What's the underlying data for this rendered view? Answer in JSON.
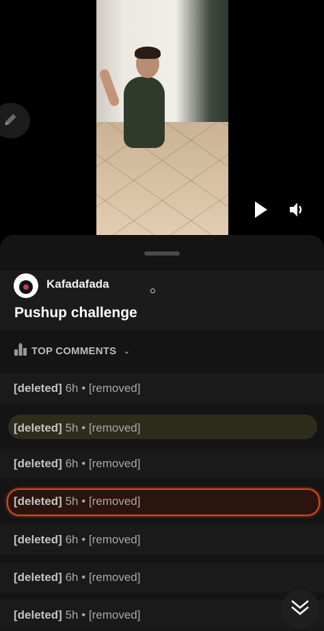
{
  "post": {
    "username": "Kafadafada",
    "title": "Pushup challenge"
  },
  "comments_header": {
    "label": "TOP COMMENTS",
    "chevron": "⌄"
  },
  "comments": [
    {
      "author": "[deleted]",
      "meta": "6h • [removed]",
      "highlight": "none"
    },
    {
      "author": "[deleted]",
      "meta": "5h • [removed]",
      "highlight": "olive"
    },
    {
      "author": "[deleted]",
      "meta": "6h • [removed]",
      "highlight": "none"
    },
    {
      "author": "[deleted]",
      "meta": "5h • [removed]",
      "highlight": "orange"
    },
    {
      "author": "[deleted]",
      "meta": "6h • [removed]",
      "highlight": "none"
    },
    {
      "author": "[deleted]",
      "meta": "6h • [removed]",
      "highlight": "none"
    },
    {
      "author": "[deleted]",
      "meta": "5h • [removed]",
      "highlight": "none"
    }
  ],
  "icons": {
    "edit": "pencil-icon",
    "play": "play-icon",
    "volume": "volume-icon",
    "sort": "trophy-icon",
    "scroll_down": "double-chevron-down-icon"
  },
  "colors": {
    "sheet_bg": "#141414",
    "highlight_olive": "#2e2d1c",
    "highlight_orange_border": "#d14a19"
  }
}
